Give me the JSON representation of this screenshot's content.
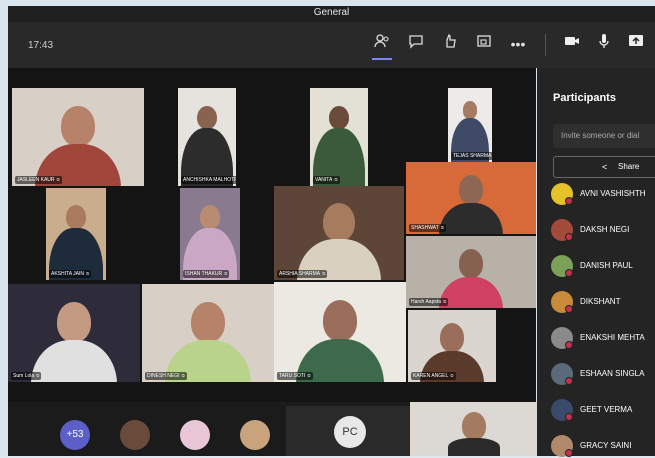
{
  "window": {
    "title": "General"
  },
  "meeting": {
    "time": "17:43"
  },
  "controls": [
    "participants-icon",
    "chat-icon",
    "reactions-icon",
    "rooms-icon",
    "more-icon",
    "camera-icon",
    "mic-icon",
    "share-icon"
  ],
  "tiles": [
    {
      "name": "JASLEEN KAUR",
      "bg": "#d8cfc6",
      "skin": "#b7826a",
      "cloth": "#a0463a"
    },
    {
      "name": "ANCHISHKA MALHOTRA",
      "bg": "#e6e3df",
      "skin": "#8a6350",
      "cloth": "#2c2c2c"
    },
    {
      "name": "VANITA",
      "bg": "#e3e0d6",
      "skin": "#6b4a3a",
      "cloth": "#3a5a3a"
    },
    {
      "name": "TEJAS SHARMA",
      "bg": "#ecebe7",
      "skin": "#a77a62",
      "cloth": "#3e4a66"
    },
    {
      "name": "AKSHITA JAIN",
      "bg": "#c9ad8c",
      "skin": "#a97a5d",
      "cloth": "#1e2b3b"
    },
    {
      "name": "ISHAN THAKUR",
      "bg": "#8a7a8f",
      "skin": "#b98c72",
      "cloth": "#caa7c5"
    },
    {
      "name": "ARSHIA SHARMA",
      "bg": "#5d4637",
      "skin": "#a77b5e",
      "cloth": "#d9d0c0"
    },
    {
      "name": "SHASHWAT",
      "bg": "#d86a3a",
      "skin": "#8e6754",
      "cloth": "#2c2c2c"
    },
    {
      "name": "Harsh Aapsta",
      "bg": "#b7b1a8",
      "skin": "#876150",
      "cloth": "#d04060"
    },
    {
      "name": "Sum Lola",
      "bg": "#2e2c3a",
      "skin": "#c49a82",
      "cloth": "#e0e0e0"
    },
    {
      "name": "DINESH NEGI",
      "bg": "#d8cfc6",
      "skin": "#b7826a",
      "cloth": "#b9d48a"
    },
    {
      "name": "TARU SOTI",
      "bg": "#ece9e2",
      "skin": "#9a6e5a",
      "cloth": "#3c6a4a"
    },
    {
      "name": "KAREN ANGEL",
      "bg": "#dad6cf",
      "skin": "#9a6e5a",
      "cloth": "#5a3a2a"
    }
  ],
  "overflow": {
    "count_label": "+53"
  },
  "pc_label": "PC",
  "panel": {
    "title": "Participants",
    "invite_placeholder": "Invite someone or dial",
    "share_label": "Share"
  },
  "participants": [
    {
      "name": "AVNI VASHISHTH",
      "color": "#e6c12a"
    },
    {
      "name": "DAKSH NEGI",
      "color": "#a34a3a"
    },
    {
      "name": "DANISH PAUL",
      "color": "#7aa05a"
    },
    {
      "name": "DIKSHANT",
      "color": "#c98a3a"
    },
    {
      "name": "ENAKSHI MEHTA",
      "color": "#8a8a8a"
    },
    {
      "name": "ESHAAN SINGLA",
      "color": "#5a6a7a"
    },
    {
      "name": "GEET VERMA",
      "color": "#3a4a6a"
    },
    {
      "name": "GRACY SAINI",
      "color": "#b08a6a"
    }
  ]
}
